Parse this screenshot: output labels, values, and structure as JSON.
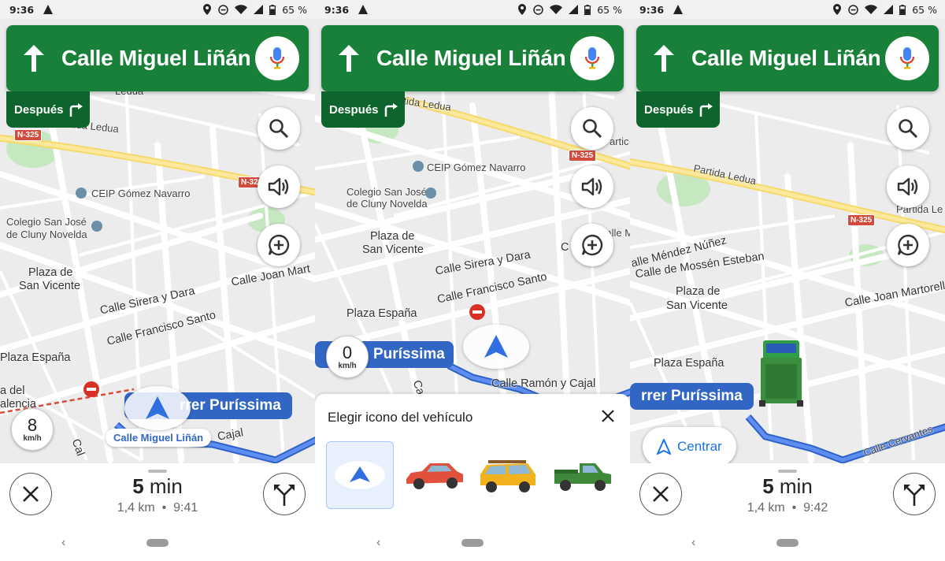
{
  "status": {
    "time": "9:36",
    "battery": "65 %"
  },
  "guidance": {
    "street": "Calle Miguel Liñán",
    "then_label": "Después"
  },
  "screens": [
    {
      "map_labels": [
        "Ledua",
        "Partida Ledua",
        "N-325",
        "N-32",
        "CEIP Gómez Navarro",
        "Colegio San José",
        "de Cluny Novelda",
        "Plaza de",
        "San Vicente",
        "Calle Joan Mart",
        "Calle Sirera y Dara",
        "Calle Francisco Santo",
        "Plaza España",
        "a del",
        "alencia",
        "Cajal",
        "Cal"
      ],
      "route_pill": "rrer Puríssima",
      "street_chip": "Calle Miguel Liñán",
      "speed": {
        "value": "8",
        "unit": "km/h"
      },
      "trip": {
        "duration": "5",
        "duration_unit": "min",
        "distance": "1,4 km",
        "arrival": "9:41"
      }
    },
    {
      "map_labels": [
        "rtida Ledua",
        "N-325",
        "artic",
        "CEIP Gómez Navarro",
        "Colegio San José",
        "de Cluny Novelda",
        "Plaza de",
        "San Vicente",
        "Calle Sirera y Dara",
        "Calle Francisco Santo",
        "C",
        "Calle M",
        "Plaza España",
        "Ca",
        "Calle Ramón y Cajal"
      ],
      "route_pill": "Puríssima",
      "speed": {
        "value": "0",
        "unit": "km/h"
      },
      "picker": {
        "title": "Elegir icono del vehículo",
        "options": [
          "navigation-arrow",
          "red-car",
          "yellow-suv",
          "green-pickup"
        ],
        "selected": "navigation-arrow"
      }
    },
    {
      "map_labels": [
        "Partida Ledua",
        "N-325",
        "Partida Le",
        "alle Méndez Núñez",
        "Calle de Mossén Esteban",
        "Plaza de",
        "San Vicente",
        "Calle Joan Martorell",
        "Plaza España",
        "Calle Cervantes"
      ],
      "route_pill": "rrer Puríssima",
      "recenter_label": "Centrar",
      "trip": {
        "duration": "5",
        "duration_unit": "min",
        "distance": "1,4 km",
        "arrival": "9:42"
      }
    }
  ],
  "colors": {
    "guide_green": "#188038",
    "then_green": "#0d652d",
    "route_blue": "#3166c5",
    "accent_blue": "#1a73e8"
  }
}
